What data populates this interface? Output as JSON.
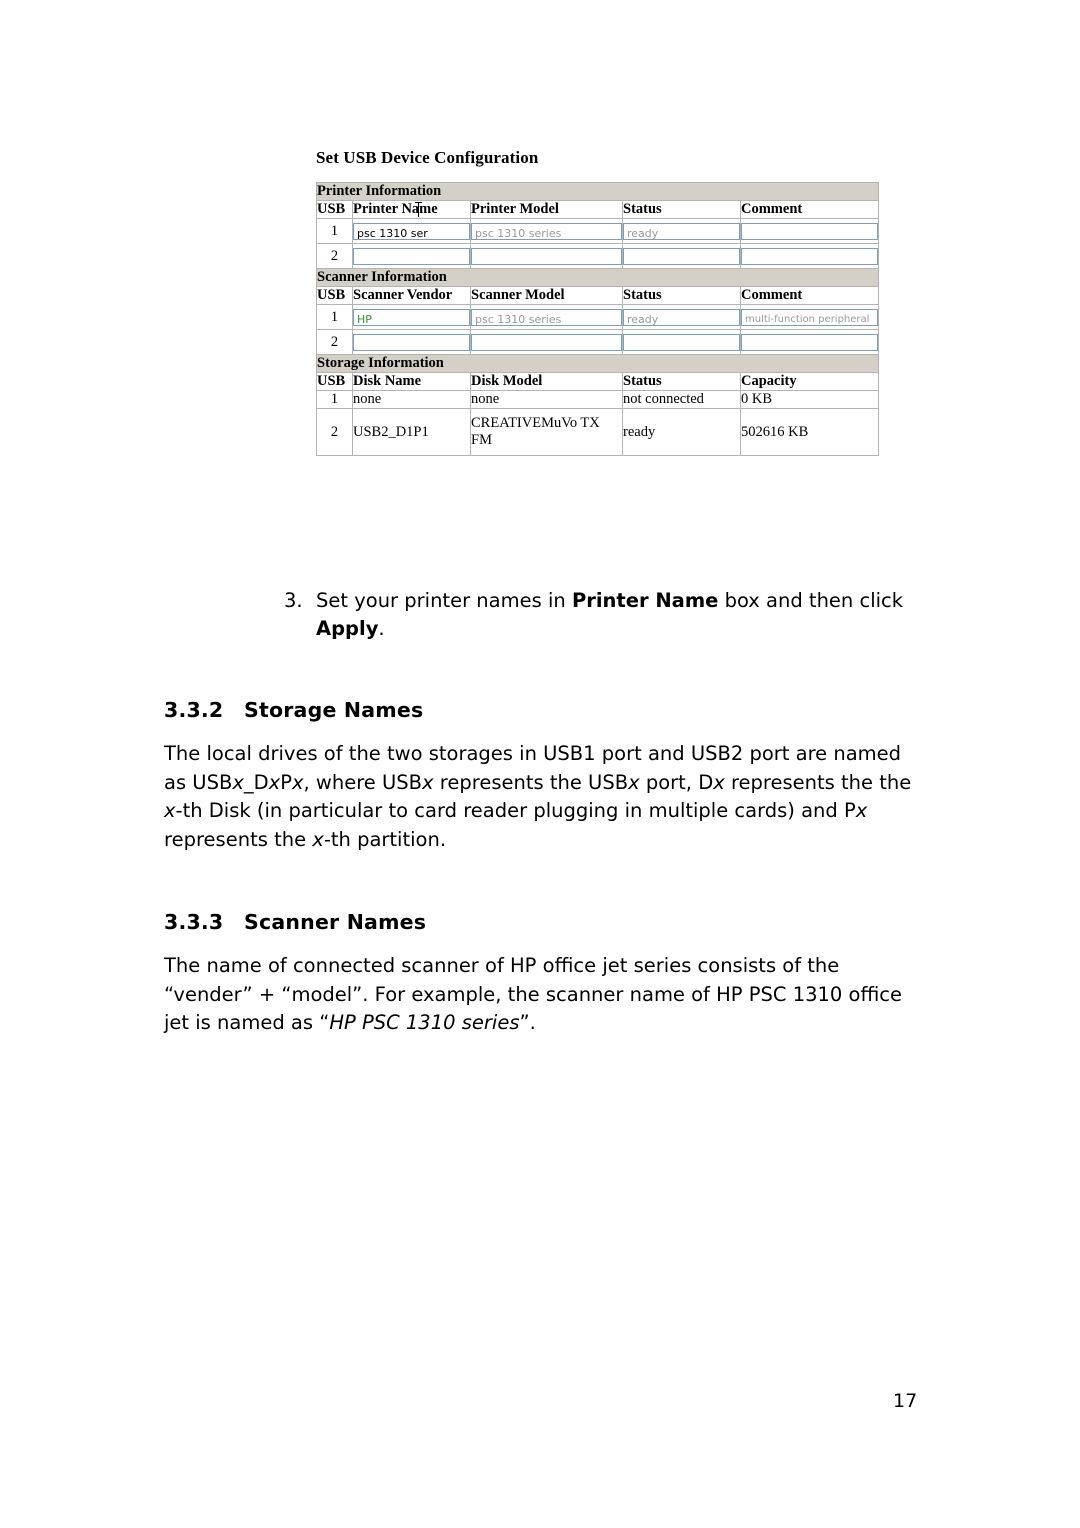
{
  "figure": {
    "title": "Set USB Device Configuration",
    "sections": [
      {
        "name": "printer",
        "heading": "Printer Information",
        "columns": [
          "USB",
          "Printer Name",
          "Printer Model",
          "Status",
          "Comment"
        ],
        "rows": [
          {
            "usb": "1",
            "name": "psc 1310 ser",
            "model": "psc 1310 series",
            "status": "ready",
            "comment": ""
          },
          {
            "usb": "2",
            "name": "",
            "model": "",
            "status": "",
            "comment": ""
          }
        ]
      },
      {
        "name": "scanner",
        "heading": "Scanner Information",
        "columns": [
          "USB",
          "Scanner Vendor",
          "Scanner Model",
          "Status",
          "Comment"
        ],
        "rows": [
          {
            "usb": "1",
            "name": "HP",
            "model": "psc 1310 series",
            "status": "ready",
            "comment": "multi-function peripheral"
          },
          {
            "usb": "2",
            "name": "",
            "model": "",
            "status": "",
            "comment": ""
          }
        ]
      },
      {
        "name": "storage",
        "heading": "Storage Information",
        "columns": [
          "USB",
          "Disk Name",
          "Disk Model",
          "Status",
          "Capacity"
        ],
        "rows": [
          {
            "usb": "1",
            "name": "none",
            "model": "none",
            "status": "not connected",
            "capacity": "0 KB"
          },
          {
            "usb": "2",
            "name": "USB2_D1P1",
            "model": "CREATIVEMuVo TX FM",
            "status": "ready",
            "capacity": "502616 KB"
          }
        ]
      }
    ]
  },
  "step": {
    "number": "3.",
    "text_before": "Set your printer names in ",
    "bold1": "Printer Name",
    "text_mid": " box and then click ",
    "bold2": "Apply",
    "text_after": "."
  },
  "sections": [
    {
      "number": "3.3.2",
      "title": "Storage Names",
      "paragraph_parts": [
        "The local drives of the two storages in USB1 port and USB2 port are named as USB",
        "x",
        "_D",
        "x",
        "P",
        "x",
        ", where USB",
        "x",
        " represents the USB",
        "x",
        " port, D",
        "x",
        " represents the the ",
        "x",
        "-th Disk (in particular to card reader plugging in multiple cards) and P",
        "x",
        " represents the ",
        "x",
        "-th partition."
      ]
    },
    {
      "number": "3.3.3",
      "title": "Scanner Names",
      "paragraph_before": "The name of connected scanner of HP office jet series consists of the “vender” + “model”. For example, the scanner name of HP PSC 1310 office jet is named as “",
      "paragraph_italic": "HP PSC 1310 series",
      "paragraph_after": "”."
    }
  ],
  "page_number": "17"
}
